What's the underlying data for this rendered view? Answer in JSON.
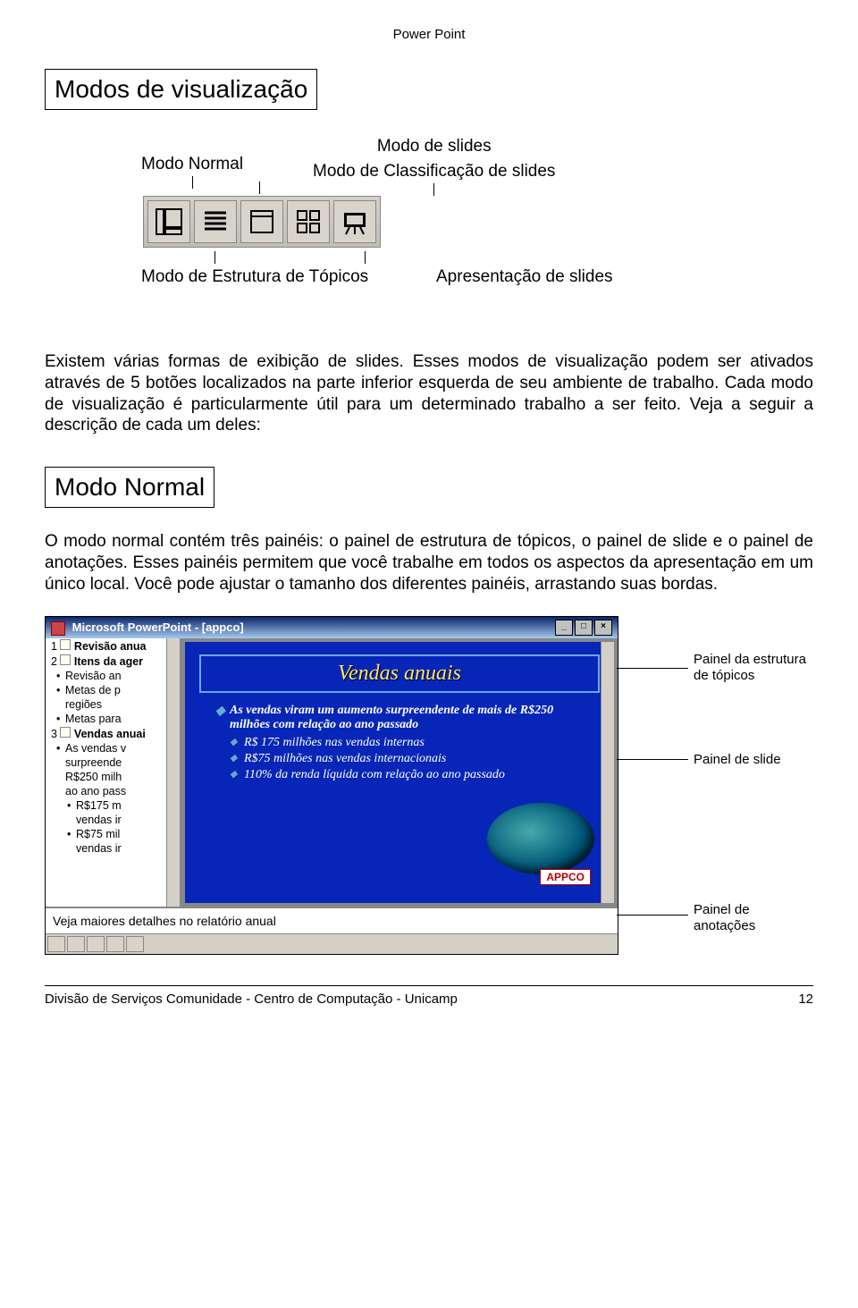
{
  "doc_header": "Power Point",
  "h1": "Modos de visualização",
  "diagram": {
    "normal": "Modo Normal",
    "slides": "Modo de slides",
    "classif": "Modo de Classificação de slides",
    "estrutura": "Modo de Estrutura de Tópicos",
    "apres": "Apresentação de slides"
  },
  "para1": "Existem várias formas de exibição de slides. Esses modos de visualização podem ser ativados através de 5 botões localizados na parte inferior esquerda de seu ambiente de trabalho. Cada modo de visualização é particularmente útil para um determinado trabalho a ser feito. Veja a seguir a descrição de cada um deles:",
  "h2": "Modo Normal",
  "para2": "O modo normal contém três painéis: o painel de estrutura de tópicos, o painel de slide e o painel de anotações. Esses painéis permitem que você trabalhe em todos os aspectos da apresentação em um único local. Você pode ajustar o tamanho dos diferentes painéis, arrastando suas bordas.",
  "screenshot": {
    "title": "Microsoft PowerPoint - [appco]",
    "outline": [
      {
        "type": "h",
        "num": "1",
        "text": "Revisão anua"
      },
      {
        "type": "h",
        "num": "2",
        "text": "Itens da ager"
      },
      {
        "type": "b1",
        "text": "Revisão an"
      },
      {
        "type": "b1",
        "text": "Metas de p"
      },
      {
        "type": "plain",
        "text": "regiões"
      },
      {
        "type": "b1",
        "text": "Metas para"
      },
      {
        "type": "h",
        "num": "3",
        "text": "Vendas anuai"
      },
      {
        "type": "b1",
        "text": "As vendas v"
      },
      {
        "type": "plain",
        "text": "surpreende"
      },
      {
        "type": "plain",
        "text": "R$250 milh"
      },
      {
        "type": "plain",
        "text": "ao ano pass"
      },
      {
        "type": "b2",
        "text": "R$175 m"
      },
      {
        "type": "plain2",
        "text": "vendas ir"
      },
      {
        "type": "b2",
        "text": "R$75 mil"
      },
      {
        "type": "plain2",
        "text": "vendas ir"
      }
    ],
    "slide_title": "Vendas anuais",
    "slide_bullets_lv1": "As vendas viram um aumento surpreendente de mais de R$250 milhões com relação ao ano passado",
    "slide_bullets_lv2": [
      "R$ 175 milhões nas vendas internas",
      "R$75 milhões nas vendas internacionais",
      "110% da renda líquida com relação ao ano passado"
    ],
    "logo_text": "APPCO",
    "notes": "Veja maiores detalhes no relatório anual"
  },
  "callouts": {
    "topicos": "Painel da estrutura de tópicos",
    "slide": "Painel de slide",
    "anot": "Painel de anotações"
  },
  "footer_left": "Divisão de Serviços Comunidade - Centro de Computação - Unicamp",
  "footer_right": "12"
}
